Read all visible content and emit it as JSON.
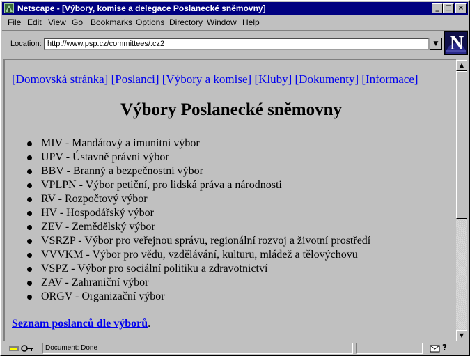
{
  "window": {
    "title": "Netscape - [Výbory, komise a delegace Poslanecké sněmovny]",
    "controls": {
      "minimize": "_",
      "maximize": "□",
      "close": "×"
    }
  },
  "menu": [
    "File",
    "Edit",
    "View",
    "Go",
    "Bookmarks",
    "Options",
    "Directory",
    "Window",
    "Help"
  ],
  "location": {
    "label": "Location:",
    "url": "http://www.psp.cz/committees/.cz2",
    "dropdown_glyph": "▼"
  },
  "logo": {
    "letter": "N"
  },
  "nav": [
    "[Domovská stránka]",
    "[Poslanci]",
    "[Výbory a komise]",
    "[Kluby]",
    "[Dokumenty]",
    "[Informace]"
  ],
  "page": {
    "heading": "Výbory Poslanecké sněmovny",
    "committees": [
      "MIV - Mandátový a imunitní výbor",
      "UPV - Ústavně právní výbor",
      "BBV - Branný a bezpečnostní výbor",
      "VPLPN - Výbor petiční, pro lidská práva a národnosti",
      "RV - Rozpočtový výbor",
      "HV - Hospodářský výbor",
      "ZEV - Zemědělský výbor",
      "VSRZP - Výbor pro veřejnou správu, regionální rozvoj a životní prostředí",
      "VVVKM - Výbor pro vědu, vzdělávání, kulturu, mládež a tělovýchovu",
      "VSPZ - Výbor pro sociální politiku a zdravotnictví",
      "ZAV - Zahraniční výbor",
      "ORGV - Organizační výbor"
    ],
    "footer_link": "Seznam poslanců dle výborů",
    "footer_punct": "."
  },
  "scrollbar": {
    "up": "▲",
    "down": "▼"
  },
  "status": {
    "text": "Document: Done",
    "help": "?"
  },
  "colors": {
    "titlebar": "#000080",
    "link": "#0000ee",
    "chrome": "#c0c0c0"
  },
  "icons": [
    "netscape-app-icon",
    "netscape-logo-icon",
    "security-key-icon",
    "mail-icon",
    "help-icon"
  ]
}
